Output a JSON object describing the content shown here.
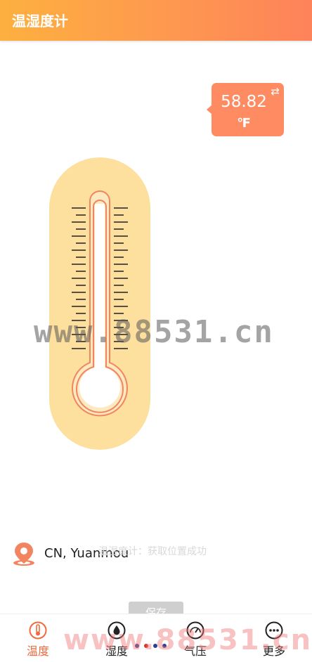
{
  "header": {
    "title": "温湿度计"
  },
  "reading": {
    "value": "58.82",
    "unit": "℉",
    "swap_icon": "swap-arrows-icon"
  },
  "watermark": {
    "text": "www.88531.cn",
    "bottom_text": "www.88531.cn"
  },
  "location": {
    "text": "CN, Yuanmou",
    "icon": "location-pin-icon"
  },
  "toast": {
    "text": "温湿度计：获取位置成功"
  },
  "save": {
    "label": "保存"
  },
  "tabs": [
    {
      "label": "温度",
      "icon": "thermometer-icon",
      "active": true
    },
    {
      "label": "湿度",
      "icon": "drop-icon",
      "active": false
    },
    {
      "label": "气压",
      "icon": "gauge-icon",
      "active": false
    },
    {
      "label": "更多",
      "icon": "more-icon",
      "active": false
    }
  ],
  "colors": {
    "accent": "#fe8b61",
    "header_start": "#fdb03f",
    "header_end": "#fe825a",
    "thermo_body": "#fddf9e",
    "thermo_tube": "#f2855f",
    "active_tab": "#f26a3d",
    "dot_blue": "#2d3f94",
    "dot_red": "#d8312f"
  }
}
